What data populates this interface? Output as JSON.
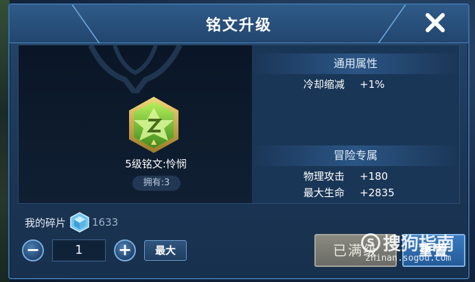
{
  "dialog": {
    "title": "铭文升级",
    "close_icon": "close-icon"
  },
  "rune": {
    "name": "5级铭文:怜悯",
    "owned": "拥有:3",
    "icon": "green-hexagon-rune-icon"
  },
  "general_attrs": {
    "header": "通用属性",
    "stats": [
      {
        "name": "冷却缩减",
        "value": "+1%"
      }
    ]
  },
  "adventure_attrs": {
    "header": "冒险专属",
    "stats": [
      {
        "name": "物理攻击",
        "value": "+180"
      },
      {
        "name": "最大生命",
        "value": "+2835"
      }
    ]
  },
  "shards": {
    "label": "我的碎片",
    "icon": "blue-crystal-icon",
    "count": "1633"
  },
  "quantity": {
    "minus": "−",
    "value": "1",
    "plus": "+",
    "max_label": "最大"
  },
  "actions": {
    "maxed_label": "已满级",
    "reset_label": "重置"
  },
  "watermark": {
    "logo_text": "搜狗指南",
    "url": "zhinan.sogou.com"
  },
  "colors": {
    "accent": "#3b6fa3",
    "rune_green": "#7ccf3a",
    "rune_gold": "#d8b54a"
  }
}
